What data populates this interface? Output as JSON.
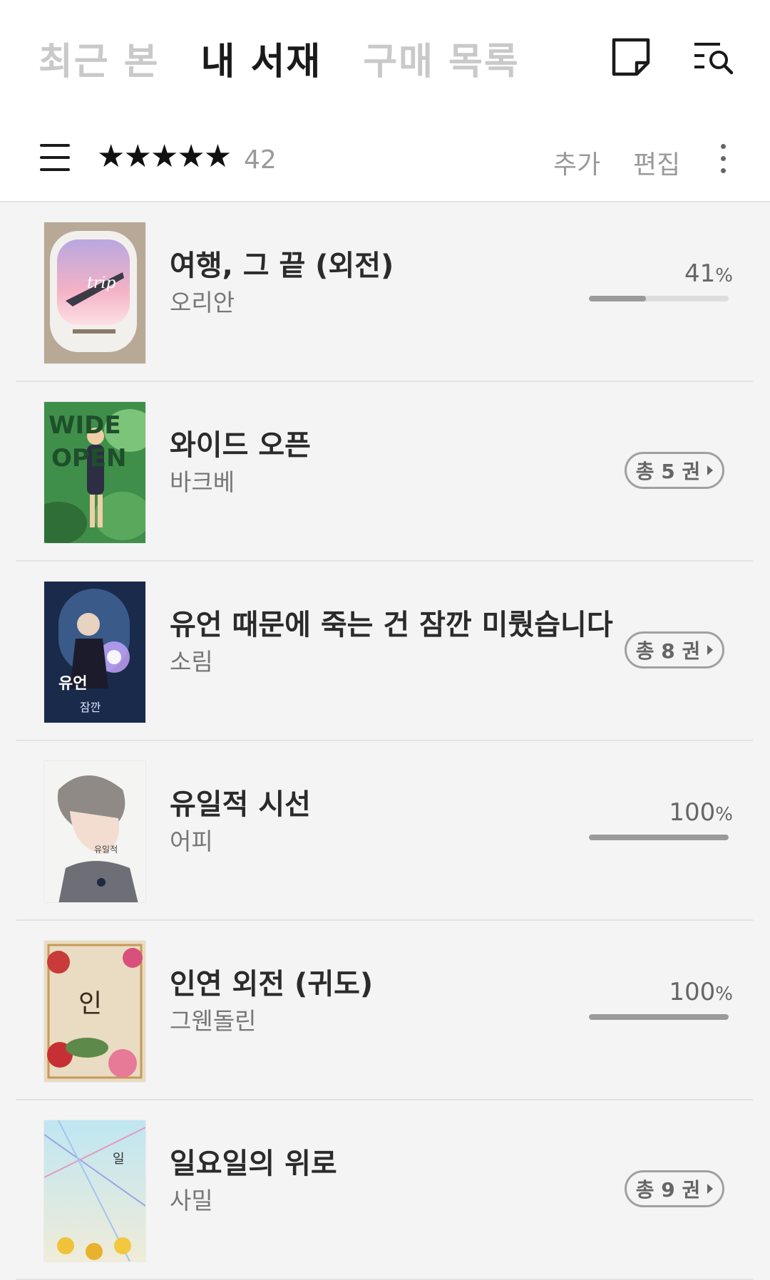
{
  "header": {
    "tabs": [
      {
        "label": "최근 본",
        "active": false
      },
      {
        "label": "내 서재",
        "active": true
      },
      {
        "label": "구매 목록",
        "active": false
      }
    ],
    "icons": [
      "memo-icon",
      "list-search-icon"
    ]
  },
  "toolbar": {
    "stars": "★★★★★",
    "star_count": "42",
    "add_label": "추가",
    "edit_label": "편집"
  },
  "books": [
    {
      "title": "여행, 그 끝 (외전)",
      "author": "오리안",
      "progress_label": "41",
      "progress_unit": "%",
      "progress": 0.41
    },
    {
      "title": "와이드 오픈",
      "author": "바크베",
      "volumes_label": "총 5 권"
    },
    {
      "title": "유언 때문에 죽는 건 잠깐 미뤘습니다",
      "author": "소림",
      "volumes_label": "총 8 권"
    },
    {
      "title": "유일적 시선",
      "author": "어피",
      "progress_label": "100",
      "progress_unit": "%",
      "progress": 1.0
    },
    {
      "title": "인연 외전 (귀도)",
      "author": "그웬돌린",
      "progress_label": "100",
      "progress_unit": "%",
      "progress": 1.0
    },
    {
      "title": "일요일의 위로",
      "author": "사밀",
      "volumes_label": "총 9 권"
    }
  ],
  "colors": {
    "active_tab": "#1a1a1a",
    "inactive_tab": "#c9c9c9",
    "background": "#f4f4f4",
    "progress_fill": "#9a9a9a"
  }
}
